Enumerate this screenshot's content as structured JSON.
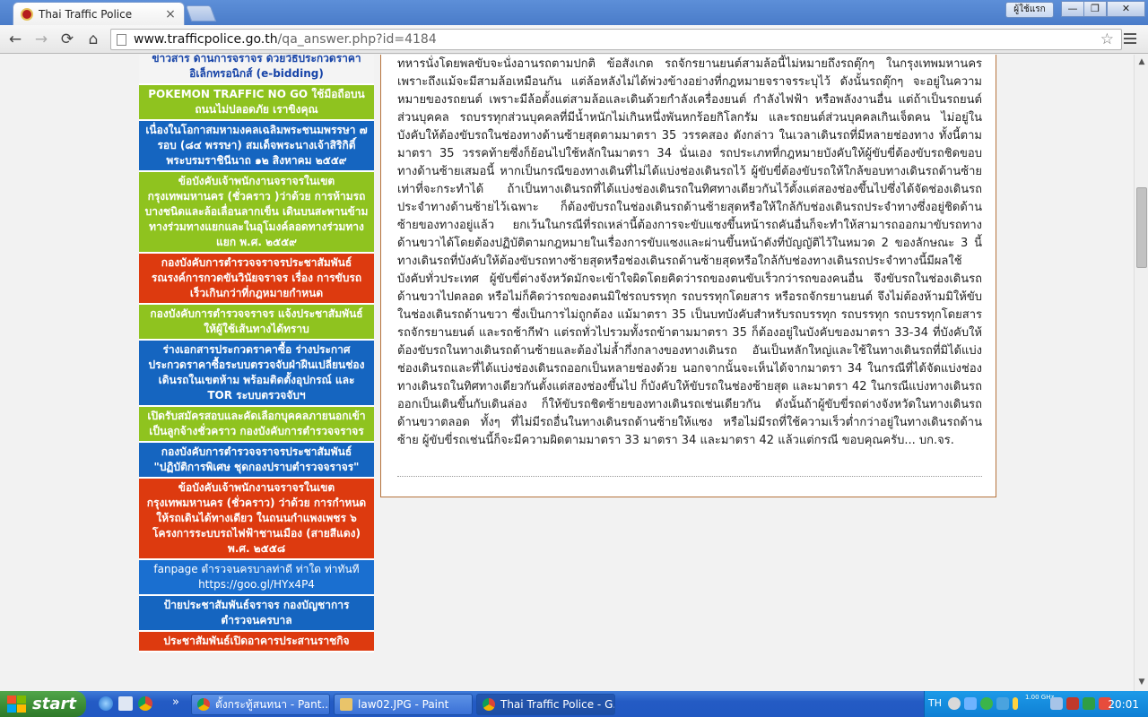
{
  "browser": {
    "tab_title": "Thai Traffic Police",
    "tab_close": "×",
    "user_button": "ผู้ใช้แรก",
    "window_controls": {
      "minimize": "—",
      "maximize": "❐",
      "close": "✕"
    },
    "nav": {
      "back": "←",
      "forward": "→",
      "reload": "⟳",
      "home": "⌂"
    },
    "url_host": "www.trafficpolice.go.th",
    "url_path": "/qa_answer.php?id=4184",
    "star": "☆"
  },
  "sidebar": {
    "items": [
      {
        "text": "ข่าวสาร ด้านการจราจร ด้วยวิธีประกวดราคาอิเล็กทรอนิกส์ (e-bidding)",
        "color": "white"
      },
      {
        "text": "POKEMON TRAFFIC NO GO ใช้มือถือบนถนนไม่ปลอดภัย เราขิงคุณ",
        "color": "green"
      },
      {
        "text": "เนื่องในโอกาสมหามงคลเฉลิมพระชนมพรรษา ๗ รอบ (๘๔ พรรษา) สมเด็จพระนางเจ้าสิริกิติ์ พระบรมราชินีนาถ ๑๒ สิงหาคม ๒๕๕๙",
        "color": "blue"
      },
      {
        "text": "ข้อบังคับเจ้าพนักงานจราจรในเขตกรุงเทพมหานคร (ชั่วคราว )ว่าด้วย การห้ามรถบางชนิดและล้อเลื่อนลากเข็น เดินบนสะพานข้ามทางร่วมทางแยกและในอุโมงค์ลอดทางร่วมทางแยก พ.ศ. ๒๕๕๙",
        "color": "green"
      },
      {
        "text": "กองบังคับการตำรวจจราจรประชาสัมพันธ์รณรงค์การกวดขันวินัยจราจร เรื่อง การขับรถเร็วเกินกว่าที่กฎหมายกำหนด",
        "color": "red"
      },
      {
        "text": "กองบังคับการตำรวจจราจร แจ้งประชาสัมพันธ์ ให้ผู้ใช้เส้นทางได้ทราบ",
        "color": "green"
      },
      {
        "text": "ร่างเอกสารประกวดราคาซื้อ ร่างประกาศประกวดราคาซื้อระบบตรวจจับฝ่าฝืนเปลี่ยนช่องเดินรถในเขตห้าม พร้อมติดตั้งอุปกรณ์ และ TOR ระบบตรวจจับฯ",
        "color": "blue"
      },
      {
        "text": "เปิดรับสมัครสอบและคัดเลือกบุคคลภายนอกเข้าเป็นลูกจ้างชั่วคราว กองบังคับการตำรวจจราจร",
        "color": "green"
      },
      {
        "text": "กองบังคับการตำรวจจราจรประชาสัมพันธ์ \"ปฏิบัติการพิเศษ ชุดกองปราบตำรวจจราจร\"",
        "color": "blue"
      },
      {
        "text": "ข้อบังคับเจ้าพนักงานจราจรในเขตกรุงเทพมหานคร (ชั่วคราว) ว่าด้วย การกำหนดให้รถเดินได้ทางเดียว ในถนนกำแพงเพชร ๖ โครงการระบบรถไฟฟ้าชานเมือง (สายสีแดง) พ.ศ. ๒๕๕๘",
        "color": "red"
      },
      {
        "text": "fanpage ตำรวจนครบาลท่าดี ท่าใด ท่าทันที https://goo.gl/HYx4P4",
        "color": "blue2"
      },
      {
        "text": "ป้ายประชาสัมพันธ์จราจร กองบัญชาการตำรวจนครบาล",
        "color": "blue"
      },
      {
        "text": "ประชาสัมพันธ์เปิดอาคารประสานราชกิจ",
        "color": "red"
      }
    ]
  },
  "answer": {
    "text": "ทหารนั่งโดยพลขับจะนั่งอานรถตามปกติ ข้อสังเกต รถจักรยานยนต์สามล้อนี้ไม่หมายถึงรถตุ๊กๆ ในกรุงเทพมหานคร เพราะถึงแม้จะมีสามล้อเหมือนกัน แต่ล้อหลังไม่ได้พ่วงข้างอย่างที่กฎหมายจราจรระบุไว้ ดังนั้นรถตุ๊กๆ จะอยู่ในความหมายของรถยนต์ เพราะมีล้อตั้งแต่สามล้อและเดินด้วยกำลังเครื่องยนต์ กำลังไฟฟ้า หรือพลังงานอื่น แต่ถ้าเป็นรถยนต์ส่วนบุคคล รถบรรทุกส่วนบุคคลที่มีน้ำหนักไม่เกินหนึ่งพันหกร้อยกิโลกรัม และรถยนต์ส่วนบุคคลเกินเจ็ดคน ไม่อยู่ในบังคับให้ต้องขับรถในช่องทางด้านซ้ายสุดตามมาตรา 35 วรรคสอง ดังกล่าว ในเวลาเดินรถที่มีหลายช่องทาง ทั้งนี้ตามมาตรา 35 วรรคท้ายซึ่งก็ย้อนไปใช้หลักในมาตรา 34 นั่นเอง รถประเภทที่กฎหมายบังคับให้ผู้ขับขี่ต้องขับรถชิดขอบทางด้านซ้ายเสมอนี้ หากเป็นกรณีของทางเดินที่ไม่ได้แบ่งช่องเดินรถไว้ ผู้ขับขี่ต้องขับรถให้ใกล้ขอบทางเดินรถด้านซ้ายเท่าที่จะกระทำได้ ถ้าเป็นทางเดินรถที่ได้แบ่งช่องเดินรถในทิศทางเดียวกันไว้ตั้งแต่สองช่องขึ้นไปซึ่งได้จัดช่องเดินรถประจำทางด้านซ้ายไว้เฉพาะ ก็ต้องขับรถในช่องเดินรถด้านซ้ายสุดหรือให้ใกล้กับช่องเดินรถประจำทางซึ่งอยู่ชิดด้านซ้ายของทางอยู่แล้ว ยกเว้นในกรณีที่รถเหล่านี้ต้องการจะขับแซงขึ้นหน้ารถคันอื่นก็จะทำให้สามารถออกมาขับรถทางด้านขวาได้โดยต้องปฏิบัติตามกฎหมายในเรื่องการขับแซงและผ่านขึ้นหน้าดังที่บัญญัติไว้ในหมวด 2 ของลักษณะ 3 นี้ ทางเดินรถที่บังคับให้ต้องขับรถทางซ้ายสุดหรือช่องเดินรถด้านซ้ายสุดหรือใกล้กับช่องทางเดินรถประจำทางนี้มีผลใช้บังคับทั่วประเทศ ผู้ขับขี่ต่างจังหวัดมักจะเข้าใจผิดโดยคิดว่ารถของตนขับเร็วกว่ารถของคนอื่น จึงขับรถในช่องเดินรถด้านขวาไปตลอด หรือไม่ก็คิดว่ารถของตนมิใช่รถบรรทุก รถบรรทุกโดยสาร หรือรถจักรยานยนต์ จึงไม่ต้องห้ามมิให้ขับในช่องเดินรถด้านขวา ซึ่งเป็นการไม่ถูกต้อง แม้มาตรา 35 เป็นบทบังคับสำหรับรถบรรทุก รถบรรทุก รถบรรทุกโดยสาร รถจักรยานยนต์ และรถช้ากีฬา แต่รถทั่วไปรวมทั้งรถข้าตามมาตรา 35 ก็ต้องอยู่ในบังคับของมาตรา 33-34 ที่บังคับให้ต้องขับรถในทางเดินรถด้านซ้ายและต้องไม่ล้ำกึ่งกลางของทางเดินรถ อันเป็นหลักใหญ่และใช้ในทางเดินรถที่มิได้แบ่งช่องเดินรถและที่ได้แบ่งช่องเดินรถออกเป็นหลายช่องด้วย นอกจากนั้นจะเห็นได้จากมาตรา 34 ในกรณีที่ได้จัดแบ่งช่องทางเดินรถในทิศทางเดียวกันตั้งแต่สองช่องขึ้นไป ก็บังคับให้ขับรถในช่องซ้ายสุด และมาตรา 42 ในกรณีแบ่งทางเดินรถออกเป็นเดินขึ้นกับเดินล่อง ก็ให้ขับรถชิดซ้ายของทางเดินรถเช่นเดียวกัน ดังนั้นถ้าผู้ขับขี่รถต่างจังหวัดในทางเดินรถด้านขวาตลอด ทั้งๆ ที่ไม่มีรถอื่นในทางเดินรถด้านซ้ายให้แซง หรือไม่มีรถที่ใช้ความเร็วต่ำกว่าอยู่ในทางเดินรถด้านซ้าย ผู้ขับขี่รถเช่นนี้ก็จะมีความผิดตามมาตรา 33 มาตรา 34 และมาตรา 42 แล้วแต่กรณี ขอบคุณครับ... บก.จร."
  },
  "taskbar": {
    "start_label": "start",
    "quicklaunch_more": "»",
    "tasks": [
      {
        "label": "ตั้งกระทู้สนทนา - Pant...",
        "icon": "chrome-icon"
      },
      {
        "label": "law02.JPG - Paint",
        "icon": "paint-icon"
      },
      {
        "label": "Thai Traffic Police - G...",
        "icon": "chrome-icon"
      }
    ],
    "language": "TH",
    "cpu_meter": "1.00 GHz",
    "clock": "20:01"
  },
  "colors": {
    "link_white": "#f4f4f4",
    "link_green": "#8fc31f",
    "link_blue": "#1565c0",
    "link_red": "#dd3a0f",
    "content_border": "#b6743d"
  }
}
